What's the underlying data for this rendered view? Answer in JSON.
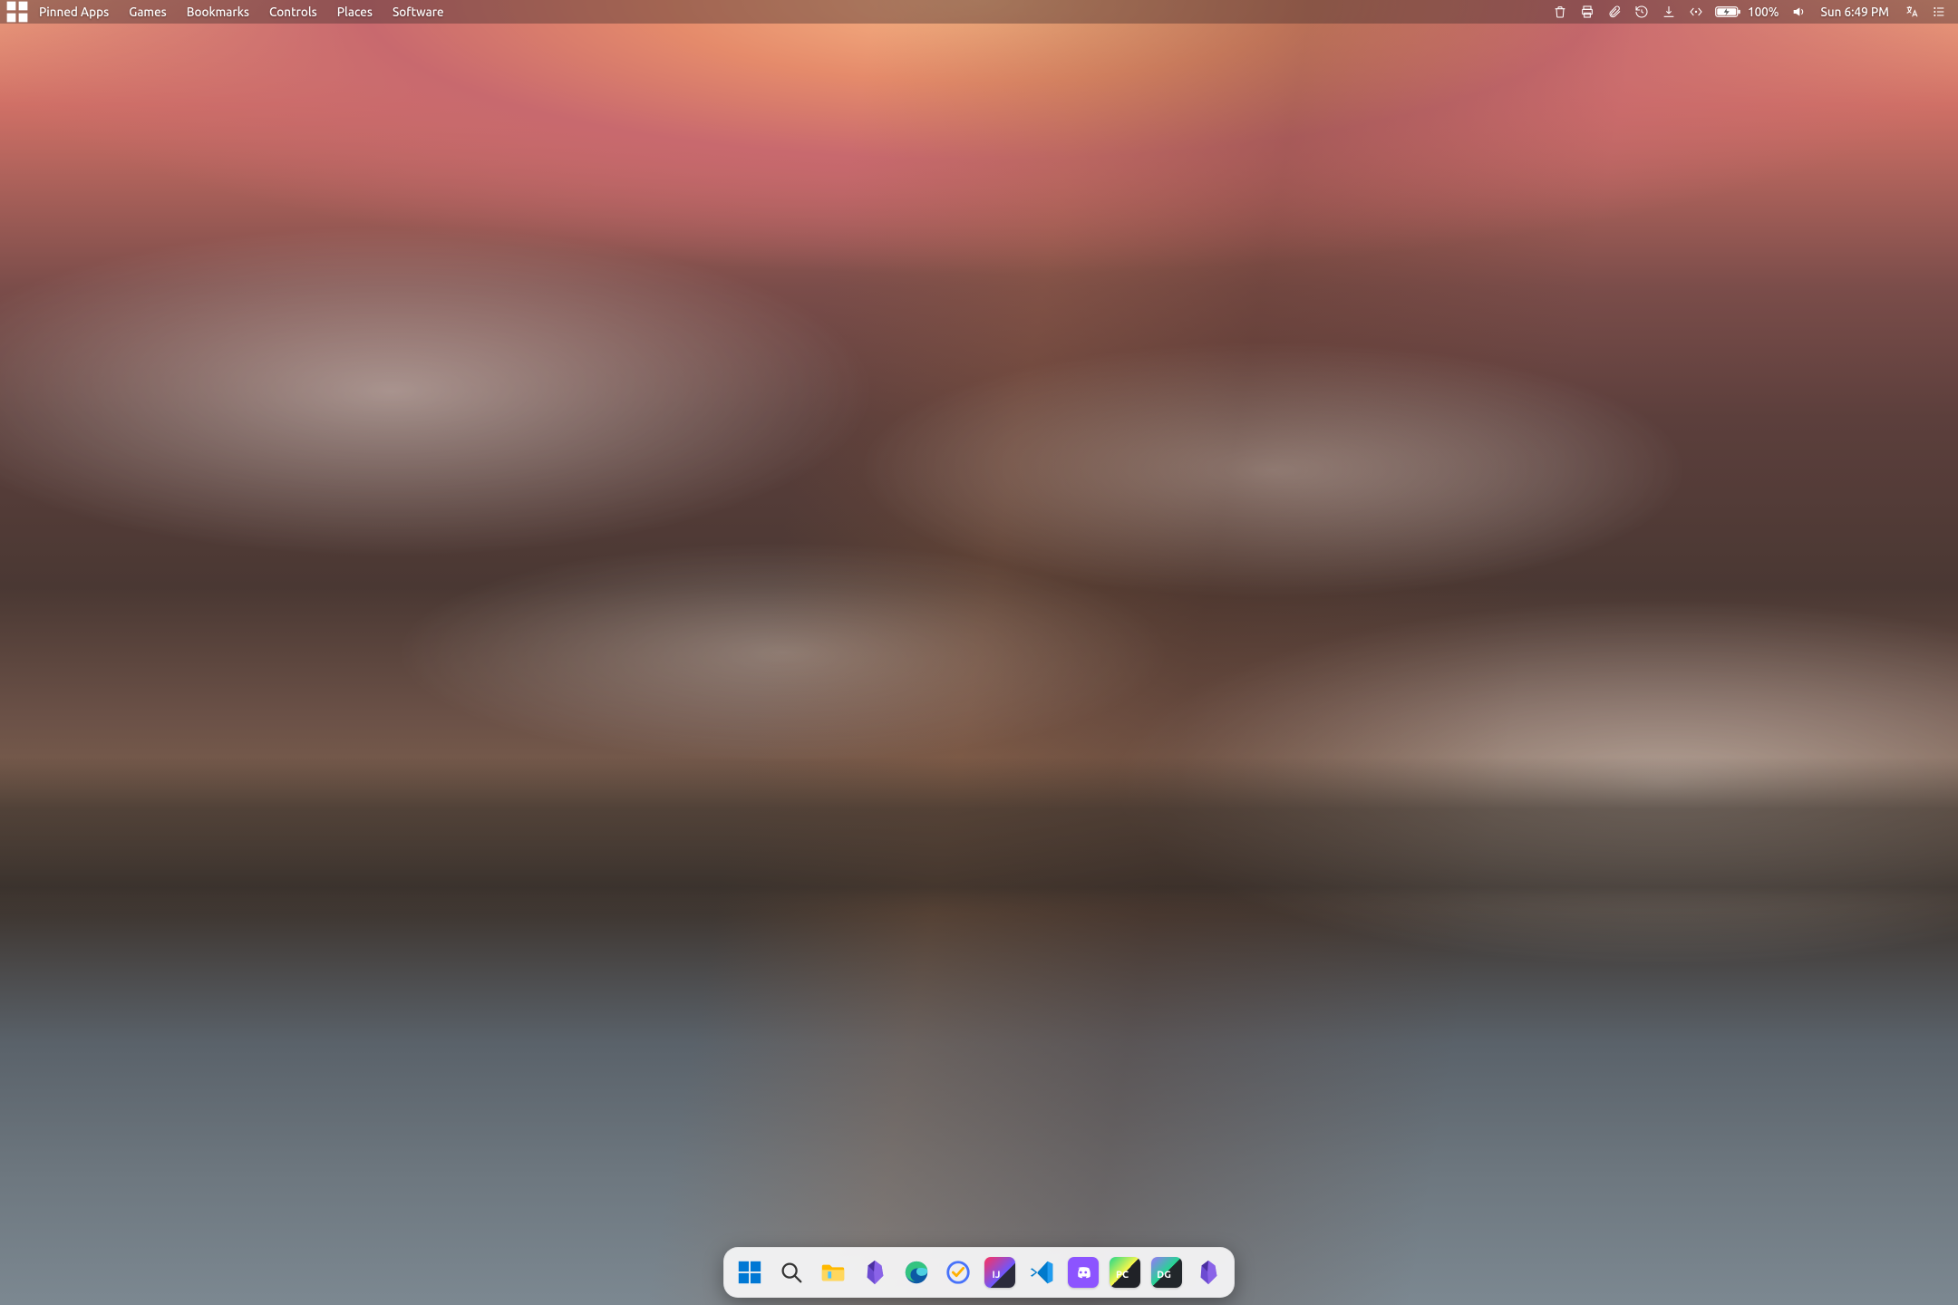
{
  "topbar": {
    "menus": [
      "Pinned Apps",
      "Games",
      "Bookmarks",
      "Controls",
      "Places",
      "Software"
    ],
    "tray_icons": [
      "trash",
      "printer",
      "attachment",
      "history",
      "download",
      "code-expand"
    ],
    "battery_percent": "100%",
    "clock": "Sun 6:49 PM",
    "right_icons": [
      "language",
      "panel-menu"
    ]
  },
  "dock": {
    "apps": [
      {
        "id": "start",
        "label": "Start"
      },
      {
        "id": "search",
        "label": "Search"
      },
      {
        "id": "files",
        "label": "File Explorer"
      },
      {
        "id": "obsidian",
        "label": "Obsidian"
      },
      {
        "id": "edge",
        "label": "Microsoft Edge"
      },
      {
        "id": "ticktick",
        "label": "TickTick"
      },
      {
        "id": "intellij",
        "label": "IntelliJ IDEA",
        "tile_text": "IJ",
        "tile_bg": "#2b2b3b",
        "tile_accent": "#fe315d"
      },
      {
        "id": "vscode",
        "label": "Visual Studio Code"
      },
      {
        "id": "discord",
        "label": "Discord"
      },
      {
        "id": "pycharm",
        "label": "PyCharm",
        "tile_text": "PC",
        "tile_bg": "#202227",
        "tile_accent": "#21d789"
      },
      {
        "id": "datagrip",
        "label": "DataGrip",
        "tile_text": "DG",
        "tile_bg": "#22272b",
        "tile_accent": "#22d88f"
      },
      {
        "id": "obsidian2",
        "label": "Obsidian"
      }
    ]
  }
}
